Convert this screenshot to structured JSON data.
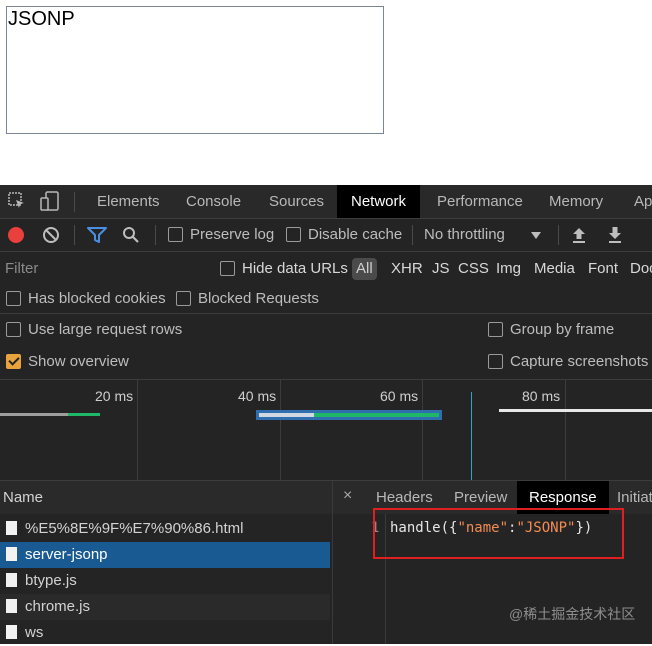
{
  "page": {
    "heading": "JSONP"
  },
  "devtools": {
    "tabs": [
      "Elements",
      "Console",
      "Sources",
      "Network",
      "Performance",
      "Memory",
      "Ap"
    ],
    "active_tab": "Network",
    "toolbar": {
      "preserve_log": "Preserve log",
      "disable_cache": "Disable cache",
      "throttling": "No throttling"
    },
    "filter": {
      "placeholder": "Filter",
      "hide_data_urls": "Hide data URLs",
      "types": [
        "All",
        "XHR",
        "JS",
        "CSS",
        "Img",
        "Media",
        "Font",
        "Doc"
      ],
      "has_blocked_cookies": "Has blocked cookies",
      "blocked_requests": "Blocked Requests"
    },
    "settings": {
      "large_rows": "Use large request rows",
      "group_by_frame": "Group by frame",
      "show_overview": "Show overview",
      "capture_screenshots": "Capture screenshots"
    },
    "overview": {
      "ticks": [
        "20 ms",
        "40 ms",
        "60 ms",
        "80 ms"
      ]
    },
    "requests": {
      "header": "Name",
      "rows": [
        "%E5%8E%9F%E7%90%86.html",
        "server-jsonp",
        "btype.js",
        "chrome.js",
        "ws"
      ],
      "selected_index": 1
    },
    "detail": {
      "close": "×",
      "tabs": [
        "Headers",
        "Preview",
        "Response",
        "Initiat"
      ],
      "active_tab": "Response",
      "response": {
        "line_number": "1",
        "prefix": "handle({",
        "key": "\"name\"",
        "colon": ":",
        "value": "\"JSONP\"",
        "suffix": "})"
      }
    },
    "watermark": "@稀土掘金技术社区",
    "colors": {
      "accent": "#e8a33d",
      "selected_row": "#1a5a93",
      "highlight_box": "#e02020"
    }
  }
}
